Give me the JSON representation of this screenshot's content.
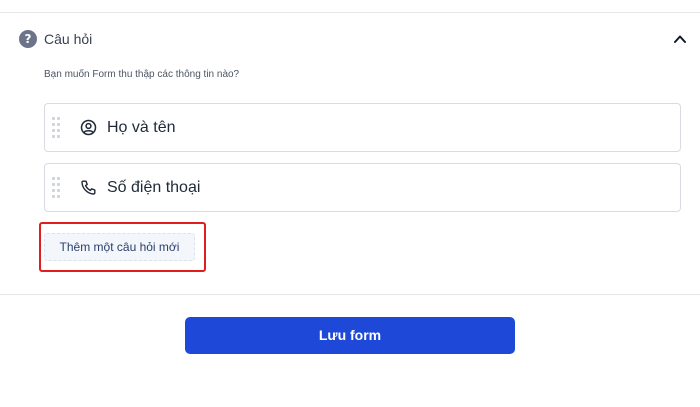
{
  "section": {
    "title": "Câu hỏi",
    "icon": "help-circle-icon",
    "toggle_icon": "chevron-up-icon",
    "prompt": "Bạn muốn Form thu thập các thông tin nào?"
  },
  "questions": [
    {
      "label": "Họ và tên",
      "icon": "user-circle-icon"
    },
    {
      "label": "Số điện thoại",
      "icon": "phone-icon"
    }
  ],
  "add_question_label": "Thêm một câu hỏi mới",
  "save_label": "Lưu form",
  "colors": {
    "primary": "#1d48d8",
    "highlight": "#e11d1d",
    "add_button_bg": "#f3f6fb"
  }
}
